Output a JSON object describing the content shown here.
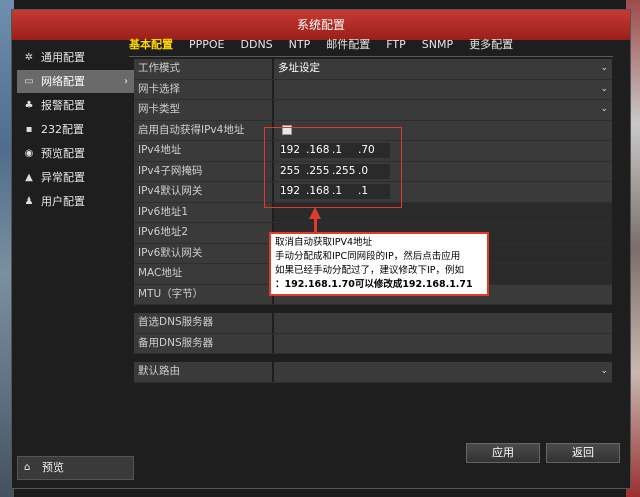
{
  "window": {
    "title": "系统配置"
  },
  "sidebar": {
    "items": [
      {
        "label": "通用配置",
        "icon": "gear-icon"
      },
      {
        "label": "网络配置",
        "icon": "network-icon",
        "active": true
      },
      {
        "label": "报警配置",
        "icon": "alarm-icon"
      },
      {
        "label": "232配置",
        "icon": "serial-icon"
      },
      {
        "label": "预览配置",
        "icon": "preview-icon"
      },
      {
        "label": "异常配置",
        "icon": "warning-icon"
      },
      {
        "label": "用户配置",
        "icon": "users-icon"
      }
    ],
    "bottom": {
      "label": "预览",
      "icon": "home-icon"
    }
  },
  "tabs": [
    "基本配置",
    "PPPOE",
    "DDNS",
    "NTP",
    "邮件配置",
    "FTP",
    "SNMP",
    "更多配置"
  ],
  "form": {
    "work_mode": {
      "label": "工作模式",
      "value": "多址设定"
    },
    "nic_select": {
      "label": "网卡选择",
      "value": ""
    },
    "nic_type": {
      "label": "网卡类型",
      "value": ""
    },
    "dhcp": {
      "label": "启用自动获得IPv4地址",
      "checked": false
    },
    "ipv4_addr": {
      "label": "IPv4地址",
      "octets": [
        "192",
        ".168",
        ".1",
        ".70"
      ]
    },
    "ipv4_mask": {
      "label": "IPv4子网掩码",
      "octets": [
        "255",
        ".255",
        ".255",
        ".0"
      ]
    },
    "ipv4_gw": {
      "label": "IPv4默认网关",
      "octets": [
        "192",
        ".168",
        ".1",
        ".1"
      ]
    },
    "ipv6_addr1": {
      "label": "IPv6地址1",
      "value": ""
    },
    "ipv6_addr2": {
      "label": "IPv6地址2",
      "value": ""
    },
    "ipv6_gw": {
      "label": "IPv6默认网关",
      "value": ""
    },
    "mac": {
      "label": "MAC地址",
      "value": ""
    },
    "mtu": {
      "label": "MTU（字节）",
      "value": ""
    },
    "dns_primary": {
      "label": "首选DNS服务器",
      "value": ""
    },
    "dns_backup": {
      "label": "备用DNS服务器",
      "value": ""
    },
    "default_route": {
      "label": "默认路由",
      "value": ""
    }
  },
  "annotation": {
    "line1": "取消自动获取IPV4地址",
    "line2": "手动分配成和IPC同网段的IP，然后点击应用",
    "line3": "如果已经手动分配过了，建议修改下IP，例如",
    "line4": "：192.168.1.70可以修改成192.168.1.71"
  },
  "buttons": {
    "apply": "应用",
    "back": "返回"
  }
}
